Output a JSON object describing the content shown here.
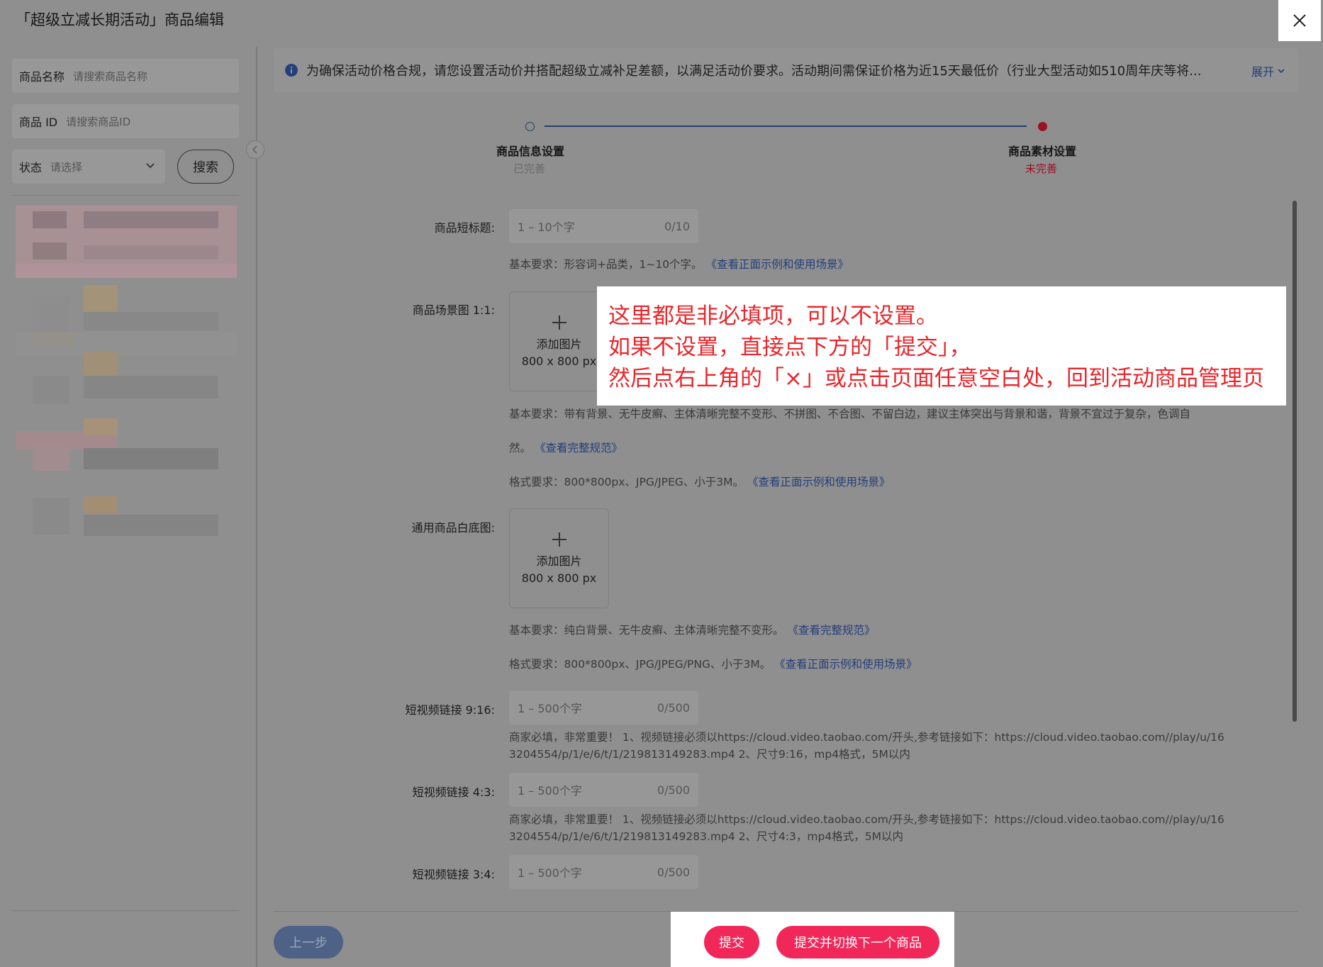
{
  "header": {
    "title": "「超级立减长期活动」商品编辑"
  },
  "sidebar": {
    "name_label": "商品名称",
    "name_placeholder": "请搜索商品名称",
    "id_label": "商品 ID",
    "id_placeholder": "请搜索商品ID",
    "status_label": "状态",
    "status_placeholder": "请选择",
    "search_button": "搜索"
  },
  "notice": {
    "text": "为确保活动价格合规，请您设置活动价并搭配超级立减补足差额，以满足活动价要求。活动期间需保证价格为近15天最低价（行业大型活动如510周年庆等将...",
    "expand_label": "展开"
  },
  "steps": [
    {
      "title": "商品信息设置",
      "status": "已完善"
    },
    {
      "title": "商品素材设置",
      "status": "未完善"
    }
  ],
  "form": {
    "short_title": {
      "label": "商品短标题:",
      "placeholder": "1 – 10个字",
      "counter": "0/10",
      "hint": "基本要求：形容词+品类，1~10个字。",
      "hint_link": "《查看正面示例和使用场景》"
    },
    "scene_image": {
      "label": "商品场景图 1:1:",
      "upload_label": "添加图片",
      "upload_size": "800 x 800 px",
      "hint1_a": "基本要求：带有背景、无牛皮癣、主体清晰完整不变形、不拼图、不合图、不留白边，建议主体突出与背景和谐，背景不宜过于复杂，色调自",
      "hint1_b": "然。",
      "hint1_link": "《查看完整规范》",
      "hint2": "格式要求：800*800px、JPG/JPEG、小于3M。",
      "hint2_link": "《查看正面示例和使用场景》"
    },
    "white_image": {
      "label": "通用商品白底图:",
      "upload_label": "添加图片",
      "upload_size": "800 x 800 px",
      "hint1": "基本要求：纯白背景、无牛皮癣、主体清晰完整不变形。",
      "hint1_link": "《查看完整规范》",
      "hint2": "格式要求：800*800px、JPG/JPEG/PNG、小于3M。",
      "hint2_link": "《查看正面示例和使用场景》"
    },
    "video_916": {
      "label": "短视频链接 9:16:",
      "placeholder": "1 – 500个字",
      "counter": "0/500",
      "hint_line1": "商家必填，非常重要！ 1、视频链接必须以https://cloud.video.taobao.com/开头,参考链接如下：https://cloud.video.taobao.com//play/u/16",
      "hint_line2": "3204554/p/1/e/6/t/1/219813149283.mp4 2、尺寸9:16，mp4格式，5M以内"
    },
    "video_43": {
      "label": "短视频链接 4:3:",
      "placeholder": "1 – 500个字",
      "counter": "0/500",
      "hint_line1": "商家必填，非常重要！ 1、视频链接必须以https://cloud.video.taobao.com/开头,参考链接如下：https://cloud.video.taobao.com//play/u/16",
      "hint_line2": "3204554/p/1/e/6/t/1/219813149283.mp4 2、尺寸4:3，mp4格式，5M以内"
    },
    "video_34": {
      "label": "短视频链接 3:4:",
      "placeholder": "1 – 500个字",
      "counter": "0/500"
    }
  },
  "footer": {
    "prev_button": "上一步",
    "submit_button": "提交",
    "submit_next_button": "提交并切换下一个商品"
  },
  "annotation": {
    "line1": "这里都是非必填项，可以不设置。",
    "line2": "如果不设置，直接点下方的「提交」，",
    "line3": "然后点右上角的「×」或点击页面任意空白处，回到活动商品管理页"
  },
  "colors": {
    "accent_pink": "#f1275a",
    "annotation_red": "#e8262b",
    "link_blue": "#24407a",
    "step_incomplete": "#9c1025"
  },
  "icons": [
    "close-icon",
    "info-icon",
    "chevron-down-icon",
    "chevron-left-icon",
    "plus-icon"
  ]
}
